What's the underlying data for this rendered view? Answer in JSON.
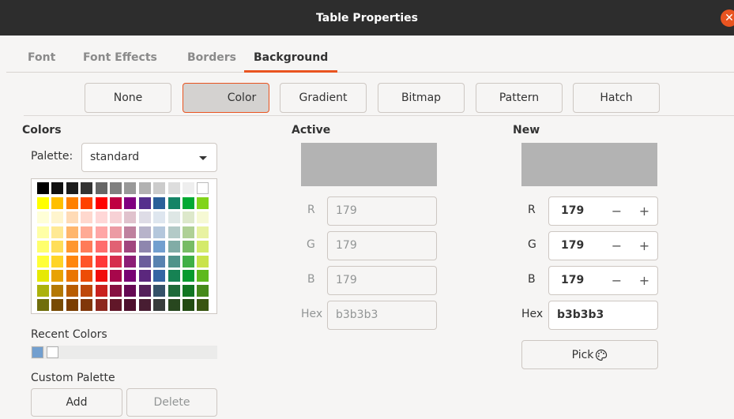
{
  "window": {
    "title": "Table Properties",
    "close_icon": "close-icon"
  },
  "tabs": [
    {
      "label": "Font",
      "active": false
    },
    {
      "label": "Font Effects",
      "active": false
    },
    {
      "label": "Borders",
      "active": false
    },
    {
      "label": "Background",
      "active": true
    }
  ],
  "fill_buttons": [
    {
      "label": "None",
      "pressed": false
    },
    {
      "label": "Color",
      "pressed": true
    },
    {
      "label": "Gradient",
      "pressed": false
    },
    {
      "label": "Bitmap",
      "pressed": false
    },
    {
      "label": "Pattern",
      "pressed": false
    },
    {
      "label": "Hatch",
      "pressed": false
    }
  ],
  "colors": {
    "heading": "Colors",
    "palette_label": "Palette:",
    "palette_value": "standard",
    "recent_label": "Recent Colors",
    "recent_colors": [
      "#729fcf",
      "#ffffff"
    ],
    "custom_label": "Custom Palette",
    "add_label": "Add",
    "delete_label": "Delete",
    "swatches": [
      [
        "#000000",
        "#111111",
        "#1c1c1c",
        "#333333",
        "#666666",
        "#808080",
        "#999999",
        "#b2b2b2",
        "#cccccc",
        "#dddddd",
        "#eeeeee",
        "#ffffff"
      ],
      [
        "#ffff00",
        "#ffbf00",
        "#ff8000",
        "#ff4000",
        "#ff0000",
        "#bf0041",
        "#800080",
        "#55308d",
        "#2a6099",
        "#158466",
        "#00a933",
        "#81d41a"
      ],
      [
        "#ffffd7",
        "#fff5ce",
        "#ffdbb6",
        "#ffd8ce",
        "#ffd7d7",
        "#f7d1d5",
        "#e0c2cd",
        "#dedce6",
        "#dee6ef",
        "#dee7e5",
        "#dde8cb",
        "#f6f9d4"
      ],
      [
        "#ffffa6",
        "#ffe994",
        "#ffb66c",
        "#ffaa95",
        "#ffa6a6",
        "#ec9ba4",
        "#bf819e",
        "#b7b3ca",
        "#b4c7dc",
        "#b3cac7",
        "#afd095",
        "#e8f2a1"
      ],
      [
        "#ffff6d",
        "#ffde59",
        "#ff972f",
        "#ff7b59",
        "#ff6d6d",
        "#e16173",
        "#a1467e",
        "#8e86ae",
        "#729fcf",
        "#81aca6",
        "#77bc65",
        "#d4ea6b"
      ],
      [
        "#ffff38",
        "#ffd428",
        "#ff860d",
        "#ff5429",
        "#ff3838",
        "#d62e4e",
        "#8d1d75",
        "#6b5e9b",
        "#5983b0",
        "#50938a",
        "#3faf46",
        "#c9e34b"
      ],
      [
        "#e6e905",
        "#e8a202",
        "#ea7500",
        "#ed4c05",
        "#f10d0c",
        "#a7074b",
        "#780373",
        "#5b277d",
        "#3465a4",
        "#168253",
        "#069a2e",
        "#5eb91e"
      ],
      [
        "#acb20c",
        "#b47804",
        "#b85c00",
        "#be480a",
        "#c9211e",
        "#861141",
        "#650953",
        "#55215b",
        "#355269",
        "#1e6a39",
        "#127622",
        "#468a1a"
      ],
      [
        "#706e0c",
        "#784b04",
        "#7b3d00",
        "#813709",
        "#8d281e",
        "#611729",
        "#4e102d",
        "#481d32",
        "#383d3c",
        "#28471f",
        "#224b12",
        "#395511"
      ]
    ]
  },
  "active": {
    "heading": "Active",
    "color": "#b3b3b3",
    "r_label": "R",
    "r": "179",
    "g_label": "G",
    "g": "179",
    "b_label": "B",
    "b": "179",
    "hex_label": "Hex",
    "hex": "b3b3b3"
  },
  "new": {
    "heading": "New",
    "color": "#b3b3b3",
    "r_label": "R",
    "r": "179",
    "g_label": "G",
    "g": "179",
    "b_label": "B",
    "b": "179",
    "hex_label": "Hex",
    "hex": "b3b3b3",
    "minus": "−",
    "plus": "+",
    "pick_label": "Pick",
    "pick_icon": "palette-icon"
  }
}
